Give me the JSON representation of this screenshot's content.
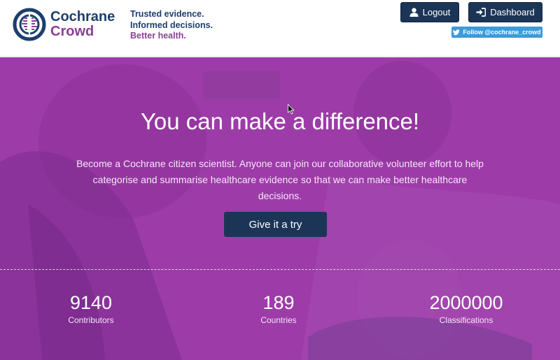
{
  "brand": {
    "name_line1": "Cochrane",
    "name_line2": "Crowd",
    "tagline": [
      "Trusted evidence.",
      "Informed decisions.",
      "Better health."
    ],
    "colors": {
      "navy": "#1d3e6e",
      "purple": "#8a3f95"
    }
  },
  "header": {
    "logout_label": "Logout",
    "dashboard_label": "Dashboard",
    "twitter_label": "Follow @cochrane_crowd"
  },
  "hero": {
    "title": "You can make a difference!",
    "text_line1": "Become a Cochrane citizen scientist. Anyone can join our collaborative volunteer effort to help",
    "text_line2": "categorise and summarise healthcare evidence so that we can make better healthcare decisions.",
    "cta_label": "Give it a try",
    "overlay_color": "#9b3aa6"
  },
  "stats": [
    {
      "value": "9140",
      "label": "Contributors"
    },
    {
      "value": "189",
      "label": "Countries"
    },
    {
      "value": "2000000",
      "label": "Classifications"
    }
  ],
  "icons": {
    "logout": "user-icon",
    "dashboard": "sign-in-icon",
    "twitter": "twitter-bird-icon",
    "logo": "cochrane-logo-icon"
  }
}
